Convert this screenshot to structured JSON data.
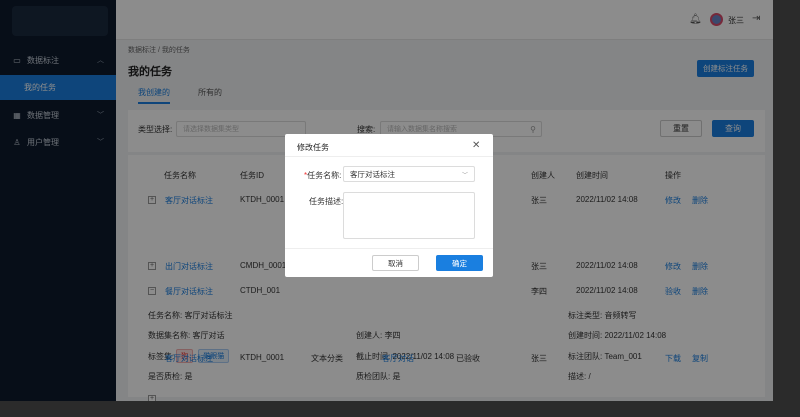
{
  "sidebar": {
    "groups": [
      {
        "label": "数据标注",
        "icon": "annotation-icon"
      },
      {
        "label": "数据管理",
        "icon": "data-manage-icon"
      },
      {
        "label": "用户管理",
        "icon": "user-manage-icon"
      }
    ],
    "active_item": "我的任务"
  },
  "topbar": {
    "user_name": "张三"
  },
  "breadcrumb": "数据标注 / 我的任务",
  "page_title": "我的任务",
  "create_button": "创建标注任务",
  "tabs": [
    "我创建的",
    "所有的"
  ],
  "filter": {
    "type_label": "类型选择:",
    "type_placeholder": "请选择数据集类型",
    "search_label": "搜索:",
    "search_placeholder": "请输入数据集名称搜索",
    "reset": "重置",
    "query": "查询"
  },
  "table": {
    "headers": [
      "任务名称",
      "任务ID",
      "创建人",
      "创建时间",
      "操作"
    ],
    "rows": [
      {
        "expand": "+",
        "name": "客厅对话标注",
        "id": "KTDH_0001",
        "creator": "张三",
        "time": "2022/11/02  14:08",
        "ops": [
          "修改",
          "删除"
        ]
      },
      {
        "expand": "+",
        "name": "出门对话标注",
        "id": "CMDH_0001",
        "creator": "张三",
        "time": "2022/11/02  14:08",
        "ops": [
          "修改",
          "删除"
        ]
      },
      {
        "expand": "−",
        "name": "餐厅对话标注",
        "id": "CTDH_001",
        "creator": "李四",
        "time": "2022/11/02  14:08",
        "ops": [
          "验收",
          "删除"
        ]
      }
    ],
    "detail": {
      "task_name": "任务名称:  客厅对话标注",
      "dataset_name": "数据集名称:  客厅对话",
      "tag_label": "标签集:",
      "tags": [
        "狗",
        "猫眼猫"
      ],
      "quality_check": "是否质检:  是",
      "annotation_type": "标注类型:  音频转写",
      "creator": "创建人:  李四",
      "deadline": "截止时间:  2022/11/02  14:08",
      "qc_team": "质检团队:  是",
      "create_time": "创建时间:  2022/11/02  14:08",
      "team": "标注团队:  Team_001",
      "description": "描述:  /"
    },
    "last_row": {
      "expand": "+",
      "name": "客厅对话标注",
      "id": "KTDH_0001",
      "type": "文本分类",
      "dataset": "客厅对话",
      "status": "已验收",
      "creator": "张三",
      "ops": [
        "下载",
        "复制"
      ]
    }
  },
  "modal": {
    "title": "修改任务",
    "name_label": "任务名称:",
    "name_value": "客厅对话标注",
    "desc_label": "任务描述:",
    "cancel": "取消",
    "confirm": "确定"
  }
}
